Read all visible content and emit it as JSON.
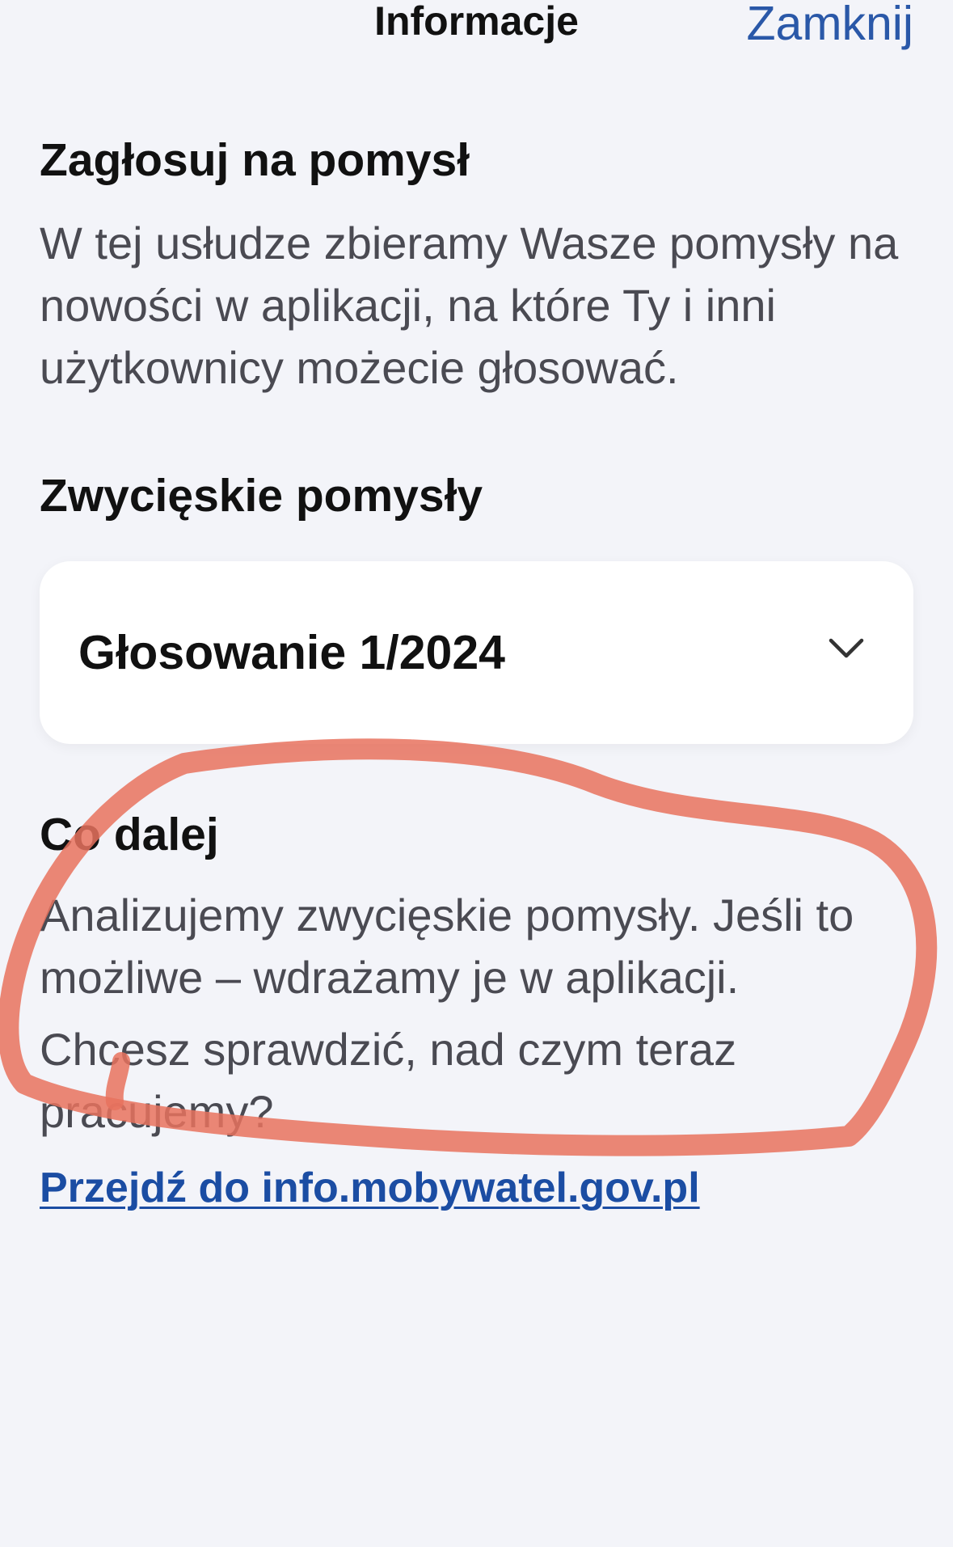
{
  "nav": {
    "title": "Informacje",
    "close_label": "Zamknij"
  },
  "vote": {
    "heading": "Zagłosuj na pomysł",
    "description": "W tej usłudze zbieramy Wasze pomysły na nowości w aplikacji, na które Ty i inni użytkownicy możecie głosować."
  },
  "winners": {
    "heading": "Zwycięskie pomysły",
    "dropdown": {
      "selected": "Głosowanie 1/2024",
      "icon": "chevron-down-icon"
    }
  },
  "next": {
    "heading": "Co dalej",
    "description": "Analizujemy zwycięskie pomysły. Jeśli to możliwe – wdrażamy je w aplikacji.",
    "check_text": "Chcesz sprawdzić, nad czym teraz pracujemy?",
    "link_label": "Przejdź do info.mobywatel.gov.pl"
  },
  "colors": {
    "background": "#f3f4f9",
    "accent": "#2a58a8",
    "link": "#1b4da3",
    "highlight_marker": "#e8725e"
  }
}
